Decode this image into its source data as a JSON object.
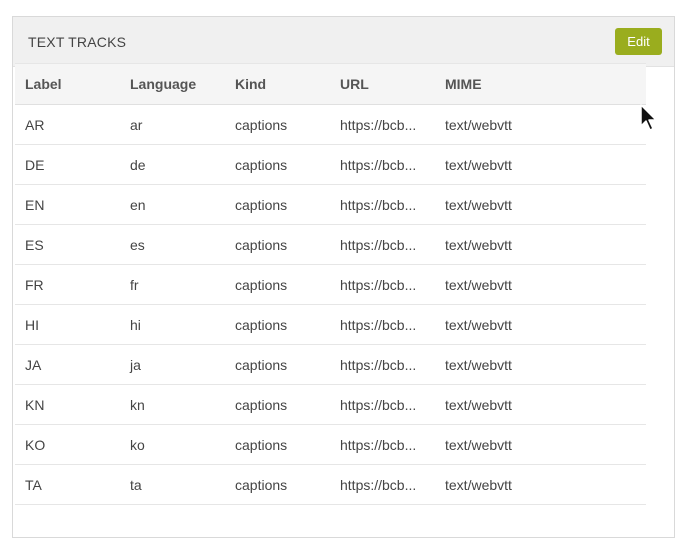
{
  "panel": {
    "title": "TEXT TRACKS",
    "edit_label": "Edit"
  },
  "colors": {
    "accent": "#9aad1e",
    "header_bg": "#f0f0f0"
  },
  "table": {
    "columns": [
      "Label",
      "Language",
      "Kind",
      "URL",
      "MIME"
    ],
    "rows": [
      [
        "AR",
        "ar",
        "captions",
        "https://bcb...",
        "text/webvtt"
      ],
      [
        "DE",
        "de",
        "captions",
        "https://bcb...",
        "text/webvtt"
      ],
      [
        "EN",
        "en",
        "captions",
        "https://bcb...",
        "text/webvtt"
      ],
      [
        "ES",
        "es",
        "captions",
        "https://bcb...",
        "text/webvtt"
      ],
      [
        "FR",
        "fr",
        "captions",
        "https://bcb...",
        "text/webvtt"
      ],
      [
        "HI",
        "hi",
        "captions",
        "https://bcb...",
        "text/webvtt"
      ],
      [
        "JA",
        "ja",
        "captions",
        "https://bcb...",
        "text/webvtt"
      ],
      [
        "KN",
        "kn",
        "captions",
        "https://bcb...",
        "text/webvtt"
      ],
      [
        "KO",
        "ko",
        "captions",
        "https://bcb...",
        "text/webvtt"
      ],
      [
        "TA",
        "ta",
        "captions",
        "https://bcb...",
        "text/webvtt"
      ]
    ]
  },
  "cursor": {
    "icon": "mouse-pointer-icon"
  }
}
